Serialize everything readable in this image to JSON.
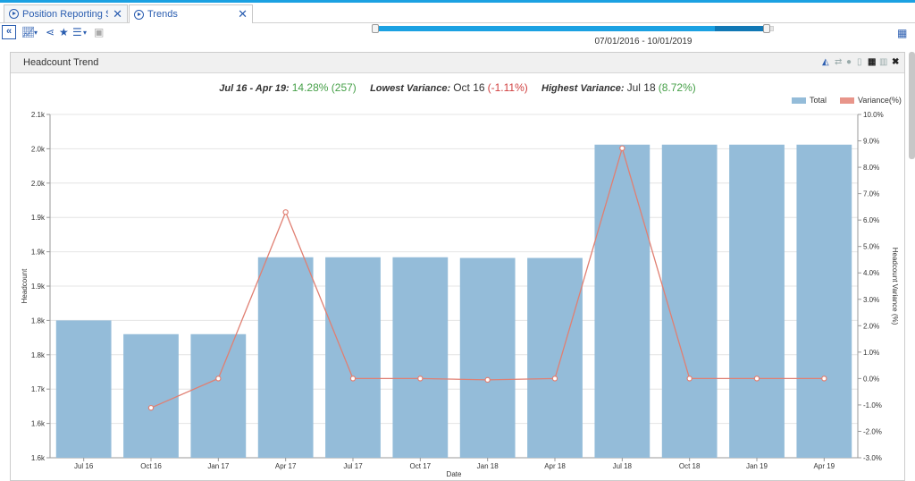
{
  "tabs": [
    {
      "label": "Position Reporting Struct...",
      "active": false
    },
    {
      "label": "Trends",
      "active": true
    }
  ],
  "toolbar": {
    "collapse_label": "«"
  },
  "date_range": {
    "label": "07/01/2016 - 10/01/2019",
    "start_fraction": 0.0,
    "end_fraction": 1.0
  },
  "panel": {
    "title": "Headcount Trend"
  },
  "summary": {
    "period_label": "Jul 16 - Apr 19:",
    "period_value": "14.28% (257)",
    "lowest_label": "Lowest Variance:",
    "lowest_period": "Oct 16",
    "lowest_value": "(-1.11%)",
    "highest_label": "Highest Variance:",
    "highest_period": "Jul 18",
    "highest_value": "(8.72%)"
  },
  "colors": {
    "accent": "#1ba1e2",
    "bar": "#94bcd9",
    "line": "#e07f72",
    "positive": "#46a048",
    "negative": "#d04040"
  },
  "chart_data": {
    "type": "bar",
    "xlabel": "Date",
    "ylabel": "Headcount",
    "y2label": "Headcount Variance (%)",
    "categories": [
      "Jul 16",
      "Oct 16",
      "Jan 17",
      "Apr 17",
      "Jul 17",
      "Oct 17",
      "Jan 18",
      "Apr 18",
      "Jul 18",
      "Oct 18",
      "Jan 19",
      "Apr 19"
    ],
    "series": [
      {
        "name": "Total",
        "axis": "left",
        "kind": "bar",
        "values": [
          1800,
          1780,
          1780,
          1892,
          1892,
          1892,
          1891,
          1891,
          2056,
          2056,
          2056,
          2056
        ]
      },
      {
        "name": "Variance(%)",
        "axis": "right",
        "kind": "line",
        "values": [
          null,
          -1.11,
          0.0,
          6.3,
          0.0,
          0.0,
          -0.05,
          0.0,
          8.72,
          0.0,
          0.0,
          0.0
        ]
      }
    ],
    "ylim": [
      1600,
      2100
    ],
    "y_ticks": [
      {
        "value": 2100,
        "label": "2.1k"
      },
      {
        "value": 2050,
        "label": "2.0k"
      },
      {
        "value": 2000,
        "label": "2.0k"
      },
      {
        "value": 1950,
        "label": "1.9k"
      },
      {
        "value": 1900,
        "label": "1.9k"
      },
      {
        "value": 1850,
        "label": "1.9k"
      },
      {
        "value": 1800,
        "label": "1.8k"
      },
      {
        "value": 1750,
        "label": "1.8k"
      },
      {
        "value": 1700,
        "label": "1.7k"
      },
      {
        "value": 1650,
        "label": "1.6k"
      },
      {
        "value": 1600,
        "label": "1.6k"
      }
    ],
    "y2lim": [
      -3.0,
      10.0
    ],
    "y2_ticks": [
      "10.0%",
      "9.0%",
      "8.0%",
      "7.0%",
      "6.0%",
      "5.0%",
      "4.0%",
      "3.0%",
      "2.0%",
      "1.0%",
      "0.0%",
      "-1.0%",
      "-2.0%",
      "-3.0%"
    ],
    "grid": true,
    "legend": "top-right"
  }
}
